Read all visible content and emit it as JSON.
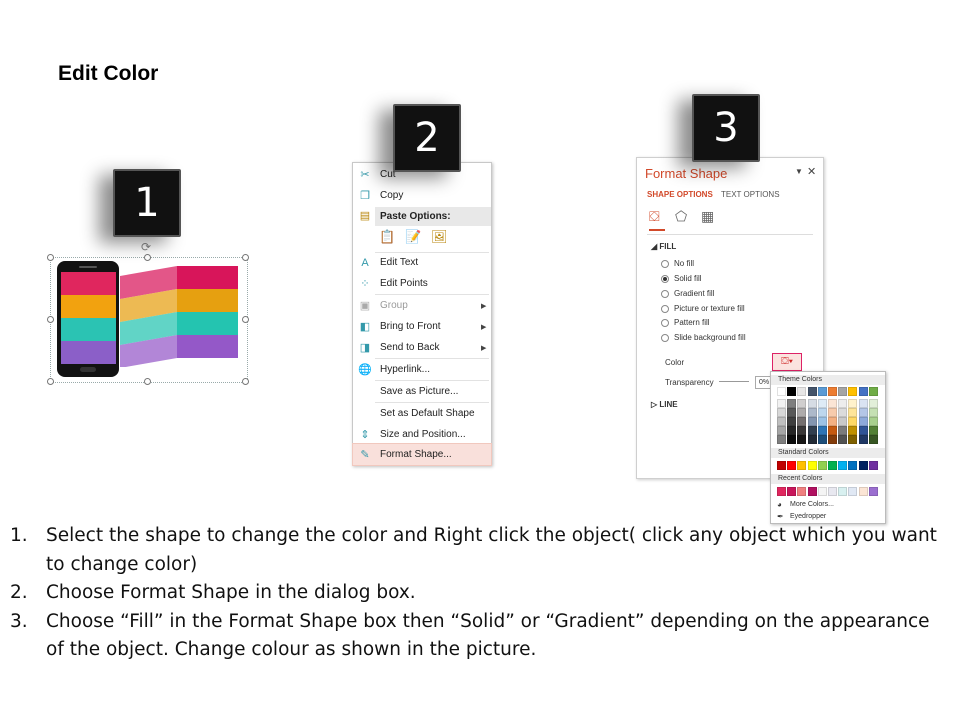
{
  "title": "Edit Color",
  "badges": [
    "1",
    "2",
    "3"
  ],
  "phone": {
    "stripe_colors": [
      "#e0265e",
      "#f2a20f",
      "#2bc3b3",
      "#8b5fc8"
    ],
    "ribbon_colors": [
      "#d8155a",
      "#e6a010",
      "#24c4b0",
      "#9458c8"
    ]
  },
  "context_menu": {
    "items": [
      {
        "label": "Cut",
        "icon": "scissors-icon",
        "glyph": "✂"
      },
      {
        "label": "Copy",
        "icon": "copy-icon",
        "glyph": "❐"
      },
      {
        "label": "Edit Text",
        "icon": "edit-text-icon",
        "glyph": "A"
      },
      {
        "label": "Edit Points",
        "icon": "edit-points-icon",
        "glyph": "⁘"
      },
      {
        "label": "Group",
        "icon": "group-icon",
        "glyph": "▣",
        "disabled": true,
        "submenu": true
      },
      {
        "label": "Bring to Front",
        "icon": "bring-front-icon",
        "glyph": "◧",
        "submenu": true
      },
      {
        "label": "Send to Back",
        "icon": "send-back-icon",
        "glyph": "◨",
        "submenu": true
      },
      {
        "label": "Hyperlink...",
        "icon": "hyperlink-icon",
        "glyph": "🌐"
      },
      {
        "label": "Save as Picture...",
        "icon": "",
        "glyph": ""
      },
      {
        "label": "Set as Default Shape",
        "icon": "",
        "glyph": ""
      },
      {
        "label": "Size and Position...",
        "icon": "size-position-icon",
        "glyph": "⇕"
      },
      {
        "label": "Format Shape...",
        "icon": "format-shape-icon",
        "glyph": "✎",
        "highlighted": true
      }
    ],
    "paste_header": "Paste Options:"
  },
  "format_pane": {
    "title": "Format Shape",
    "tabs": [
      "SHAPE OPTIONS",
      "TEXT OPTIONS"
    ],
    "fill_header": "FILL",
    "fill_options": [
      {
        "label": "No fill",
        "selected": false
      },
      {
        "label": "Solid fill",
        "selected": true
      },
      {
        "label": "Gradient fill",
        "selected": false
      },
      {
        "label": "Picture or texture fill",
        "selected": false
      },
      {
        "label": "Pattern fill",
        "selected": false
      },
      {
        "label": "Slide background fill",
        "selected": false
      }
    ],
    "color_label": "Color",
    "transparency_label": "Transparency",
    "transparency_value": "0%",
    "line_header": "LINE"
  },
  "palette": {
    "theme_header": "Theme Colors",
    "theme_top": [
      "#ffffff",
      "#000000",
      "#e7e6e6",
      "#44546a",
      "#5b9bd5",
      "#ed7d31",
      "#a5a5a5",
      "#ffc000",
      "#4472c4",
      "#70ad47"
    ],
    "theme_shade_rows": [
      [
        "#f2f2f2",
        "#7f7f7f",
        "#d0cece",
        "#d6dce4",
        "#deebf6",
        "#fbe5d5",
        "#ededed",
        "#fff2cc",
        "#dae3f3",
        "#e2efd9"
      ],
      [
        "#d8d8d8",
        "#595959",
        "#aeabab",
        "#adb9ca",
        "#bdd7ee",
        "#f7cbac",
        "#dbdbdb",
        "#fee599",
        "#b4c6e7",
        "#c5e0b3"
      ],
      [
        "#bfbfbf",
        "#3f3f3f",
        "#757070",
        "#8496b0",
        "#9dc3e6",
        "#f4b183",
        "#c9c9c9",
        "#ffd965",
        "#8eaadb",
        "#a8d08d"
      ],
      [
        "#a5a5a5",
        "#262626",
        "#3a3838",
        "#323f4f",
        "#2e75b5",
        "#c55a11",
        "#7b7b7b",
        "#bf9000",
        "#2f5496",
        "#538135"
      ],
      [
        "#7f7f7f",
        "#0c0c0c",
        "#171616",
        "#222a35",
        "#1e4e79",
        "#833c0b",
        "#525252",
        "#7f6000",
        "#1f3864",
        "#375623"
      ]
    ],
    "standard_header": "Standard Colors",
    "standard": [
      "#c00000",
      "#ff0000",
      "#ffc000",
      "#ffff00",
      "#92d050",
      "#00b050",
      "#00b0f0",
      "#0070c0",
      "#002060",
      "#7030a0"
    ],
    "recent_header": "Recent Colors",
    "recent": [
      "#e0265e",
      "#c8155a",
      "#f08080",
      "#b01060",
      "#f4f4f4",
      "#e8e8f0",
      "#d8f0f0",
      "#e0e8f4",
      "#fbe5d5",
      "#9b6fd0"
    ],
    "more_colors": "More Colors...",
    "eyedropper": "Eyedropper"
  },
  "instructions": [
    {
      "num": "1.",
      "text": "Select the shape to change the color and Right click the object( click any object which you want to change color)"
    },
    {
      "num": "2.",
      "text": "Choose Format Shape in the dialog box."
    },
    {
      "num": "3.",
      "text": "Choose “Fill” in the Format Shape box then “Solid” or “Gradient” depending on the appearance of the object. Change colour as shown in the picture."
    }
  ]
}
